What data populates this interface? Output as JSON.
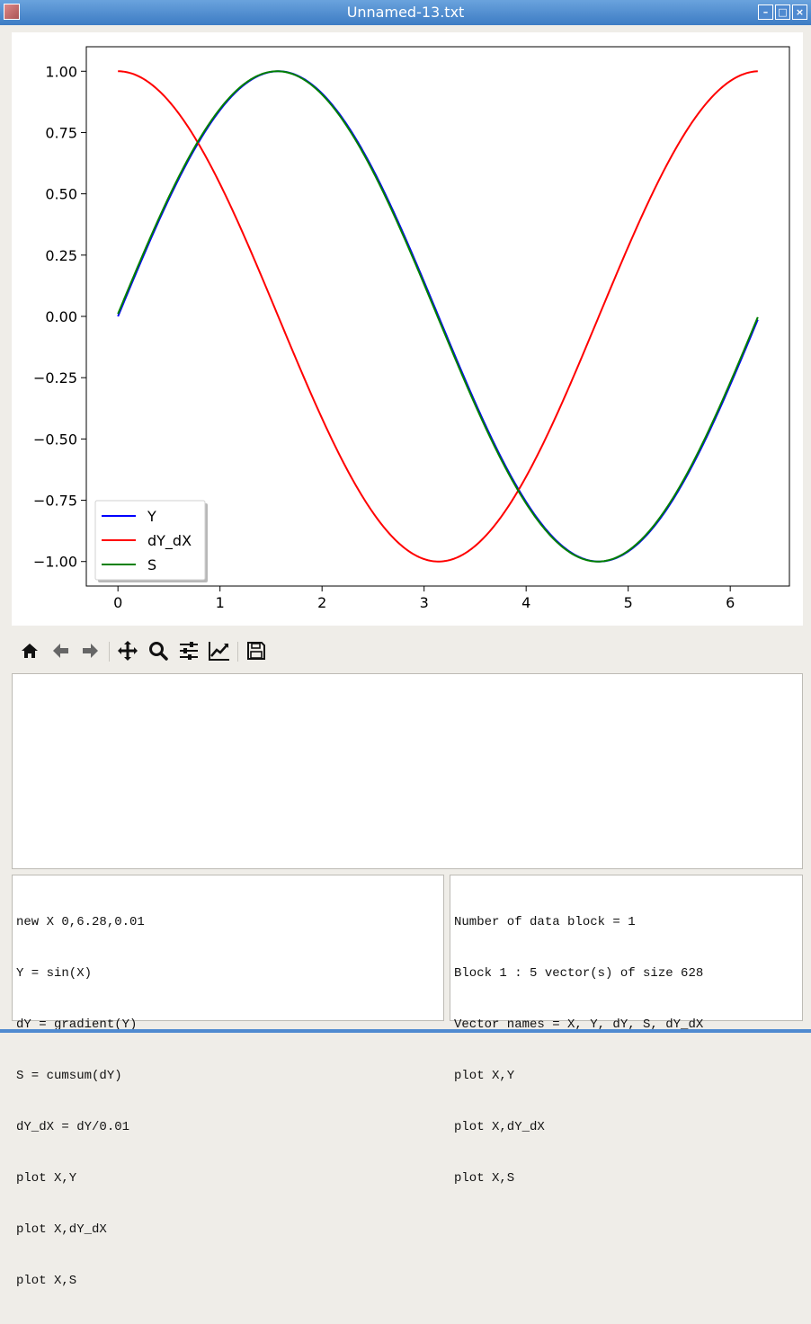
{
  "window": {
    "title": "Unnamed-13.txt",
    "minimize_glyph": "–",
    "maximize_glyph": "□",
    "close_glyph": "×"
  },
  "toolbar": {
    "icons": [
      "home-icon",
      "back-arrow-icon",
      "forward-arrow-icon",
      "pan-icon",
      "zoom-icon",
      "subplots-icon",
      "edit-axis-icon",
      "save-icon"
    ]
  },
  "colors": {
    "Y": "#0000ff",
    "dY_dX": "#ff0000",
    "S": "#008000"
  },
  "editor_lines": [
    "new X 0,6.28,0.01",
    "Y = sin(X)",
    "dY = gradient(Y)",
    "S = cumsum(dY)",
    "dY_dX = dY/0.01",
    "plot X,Y",
    "plot X,dY_dX",
    "plot X,S"
  ],
  "output_lines": [
    "Number of data block = 1",
    "Block 1 : 5 vector(s) of size 628",
    "Vector names = X, Y, dY, S, dY_dX",
    "plot X,Y",
    "plot X,dY_dX",
    "plot X,S"
  ],
  "chart_data": {
    "type": "line",
    "x_range": [
      0,
      6.27
    ],
    "xlim": [
      -0.31,
      6.58
    ],
    "ylim": [
      -1.1,
      1.1
    ],
    "xticks": [
      0,
      1,
      2,
      3,
      4,
      5,
      6
    ],
    "xtick_labels": [
      "0",
      "1",
      "2",
      "3",
      "4",
      "5",
      "6"
    ],
    "yticks": [
      1.0,
      0.75,
      0.5,
      0.25,
      0.0,
      -0.25,
      -0.5,
      -0.75,
      -1.0
    ],
    "ytick_labels": [
      "1.00",
      "0.75",
      "0.50",
      "0.25",
      "0.00",
      "−0.25",
      "−0.50",
      "−0.75",
      "−1.00"
    ],
    "grid": false,
    "legend_position": "lower-left",
    "series": [
      {
        "name": "Y",
        "function": "sin",
        "color": "#0000ff",
        "points": [
          [
            0,
            0
          ],
          [
            0.785,
            0.707
          ],
          [
            1.571,
            1.0
          ],
          [
            2.356,
            0.707
          ],
          [
            3.142,
            0.0
          ],
          [
            3.927,
            -0.707
          ],
          [
            4.712,
            -1.0
          ],
          [
            5.498,
            -0.707
          ],
          [
            6.27,
            -0.013
          ]
        ]
      },
      {
        "name": "dY_dX",
        "function": "cos",
        "color": "#ff0000",
        "points": [
          [
            0,
            1.0
          ],
          [
            0.785,
            0.707
          ],
          [
            1.571,
            0.0
          ],
          [
            2.356,
            -0.707
          ],
          [
            3.142,
            -1.0
          ],
          [
            3.927,
            -0.707
          ],
          [
            4.712,
            0.0
          ],
          [
            5.498,
            0.707
          ],
          [
            6.27,
            1.0
          ]
        ]
      },
      {
        "name": "S",
        "function": "sin_cumsum",
        "color": "#008000",
        "points": [
          [
            0,
            0.005
          ],
          [
            0.785,
            0.712
          ],
          [
            1.571,
            1.005
          ],
          [
            2.356,
            0.712
          ],
          [
            3.142,
            0.005
          ],
          [
            3.927,
            -0.702
          ],
          [
            4.712,
            -0.995
          ],
          [
            5.498,
            -0.702
          ],
          [
            6.27,
            -0.008
          ]
        ]
      }
    ]
  }
}
